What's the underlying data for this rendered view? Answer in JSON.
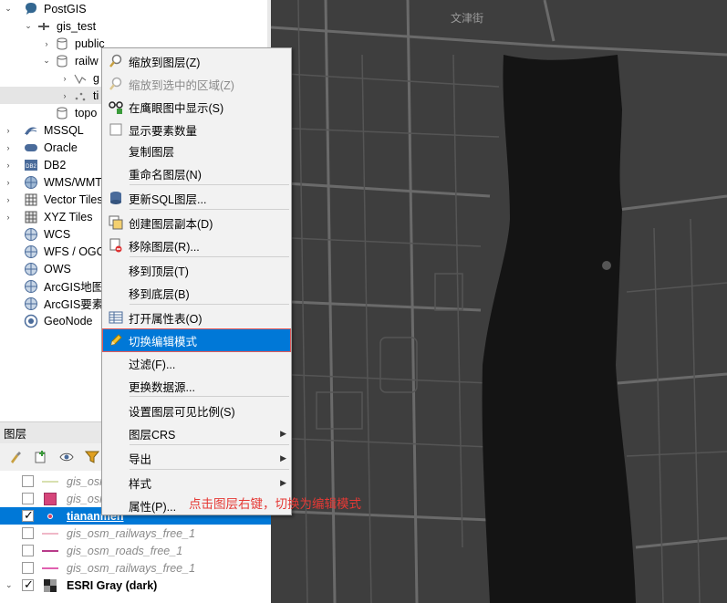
{
  "browser": {
    "items": [
      {
        "label": "PostGIS",
        "icon": "postgis-icon"
      },
      {
        "label": "gis_test",
        "icon": "connection-icon"
      },
      {
        "label": "public",
        "icon": "schema-icon"
      },
      {
        "label": "railw",
        "icon": "schema-icon"
      },
      {
        "label": "g",
        "icon": "line-layer-icon"
      },
      {
        "label": "ti",
        "icon": "point-layer-icon"
      },
      {
        "label": "topo",
        "icon": "schema-icon"
      },
      {
        "label": "MSSQL",
        "icon": "mssql-icon"
      },
      {
        "label": "Oracle",
        "icon": "oracle-icon"
      },
      {
        "label": "DB2",
        "icon": "db2-icon"
      },
      {
        "label": "WMS/WMT",
        "icon": "wms-icon"
      },
      {
        "label": "Vector Tiles",
        "icon": "vector-tiles-icon"
      },
      {
        "label": "XYZ Tiles",
        "icon": "xyz-tiles-icon"
      },
      {
        "label": "WCS",
        "icon": "wcs-icon"
      },
      {
        "label": "WFS / OGC",
        "icon": "wfs-icon"
      },
      {
        "label": "OWS",
        "icon": "ows-icon"
      },
      {
        "label": "ArcGIS地图服",
        "icon": "arcgis-map-icon"
      },
      {
        "label": "ArcGIS要素服",
        "icon": "arcgis-feature-icon"
      },
      {
        "label": "GeoNode",
        "icon": "geonode-icon"
      }
    ]
  },
  "layers": {
    "title": "图层",
    "items": [
      {
        "label": "gis_osm",
        "checked": false,
        "symbol": "#d8e0b0",
        "type": "line"
      },
      {
        "label": "gis_osm",
        "checked": false,
        "symbol": "#d6457a",
        "type": "fill"
      },
      {
        "label": "tiananmen",
        "checked": true,
        "symbol": "#d94060",
        "type": "point"
      },
      {
        "label": "gis_osm_railways_free_1",
        "checked": false,
        "symbol": "#f0b8c8",
        "type": "line"
      },
      {
        "label": "gis_osm_roads_free_1",
        "checked": false,
        "symbol": "#b83b8a",
        "type": "line"
      },
      {
        "label": "gis_osm_railways_free_1",
        "checked": false,
        "symbol": "#e060b0",
        "type": "line"
      },
      {
        "label": "ESRI Gray (dark)",
        "checked": true,
        "symbol": "raster",
        "type": "raster"
      }
    ]
  },
  "map": {
    "street_label": "文津街",
    "background": "#3e3e3e",
    "water": "#141414"
  },
  "context_menu": {
    "items": [
      {
        "label": "缩放到图层(Z)",
        "icon": "zoom-layer-icon",
        "disabled": false
      },
      {
        "label": "缩放到选中的区域(Z)",
        "icon": "zoom-selection-icon",
        "disabled": true
      },
      {
        "label": "在鹰眼图中显示(S)",
        "icon": "overview-icon",
        "disabled": false
      },
      {
        "label": "显示要素数量",
        "icon": "checkbox-icon",
        "disabled": false
      },
      {
        "label": "复制图层",
        "icon": "",
        "disabled": false
      },
      {
        "label": "重命名图层(N)",
        "icon": "",
        "disabled": false
      },
      {
        "label": "更新SQL图层...",
        "icon": "sql-layer-icon",
        "disabled": false
      },
      {
        "label": "创建图层副本(D)",
        "icon": "duplicate-layer-icon",
        "disabled": false
      },
      {
        "label": "移除图层(R)...",
        "icon": "remove-layer-icon",
        "disabled": false
      },
      {
        "label": "移到顶层(T)",
        "icon": "",
        "disabled": false
      },
      {
        "label": "移到底层(B)",
        "icon": "",
        "disabled": false
      },
      {
        "label": "打开属性表(O)",
        "icon": "attribute-table-icon",
        "disabled": false
      },
      {
        "label": "切换编辑模式",
        "icon": "pencil-icon",
        "disabled": false,
        "highlighted": true
      },
      {
        "label": "过滤(F)...",
        "icon": "",
        "disabled": false
      },
      {
        "label": "更换数据源...",
        "icon": "",
        "disabled": false
      },
      {
        "label": "设置图层可见比例(S)",
        "icon": "",
        "disabled": false
      },
      {
        "label": "图层CRS",
        "icon": "",
        "disabled": false,
        "submenu": true
      },
      {
        "label": "导出",
        "icon": "",
        "disabled": false,
        "submenu": true
      },
      {
        "label": "样式",
        "icon": "",
        "disabled": false,
        "submenu": true
      },
      {
        "label": "属性(P)...",
        "icon": "",
        "disabled": false
      }
    ]
  },
  "annotation": "点击图层右键，切换为编辑模式",
  "colors": {
    "accent": "#0078d7",
    "note": "#e53935"
  }
}
